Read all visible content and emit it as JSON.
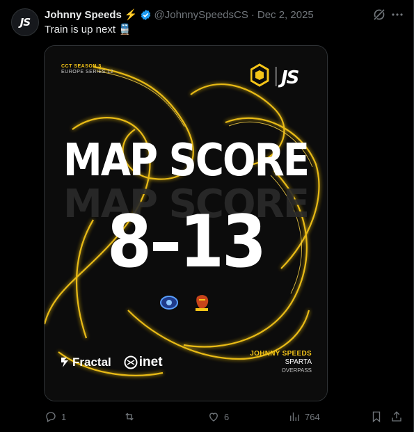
{
  "post": {
    "display_name": "Johnny Speeds",
    "handle": "@JohnnySpeedsCS",
    "separator": "·",
    "date": "Dec 2, 2025",
    "text": "Train is up next",
    "emoji": "🚆",
    "avatar_text": "JS"
  },
  "graphic": {
    "tournament_line1": "CCT SEASON 3",
    "tournament_line2": "EUROPE SERIES 12",
    "headline": "MAP SCORE",
    "score": "8–13",
    "team_a_label": "JOHNNY SPEEDS",
    "team_b_label": "SPARTA",
    "map_name": "OVERPASS",
    "sponsor1": "Fractal",
    "sponsor2": "inet",
    "accent_color": "#f5c518"
  },
  "actions": {
    "replies": "1",
    "reposts": "",
    "likes": "6",
    "views": "764"
  }
}
